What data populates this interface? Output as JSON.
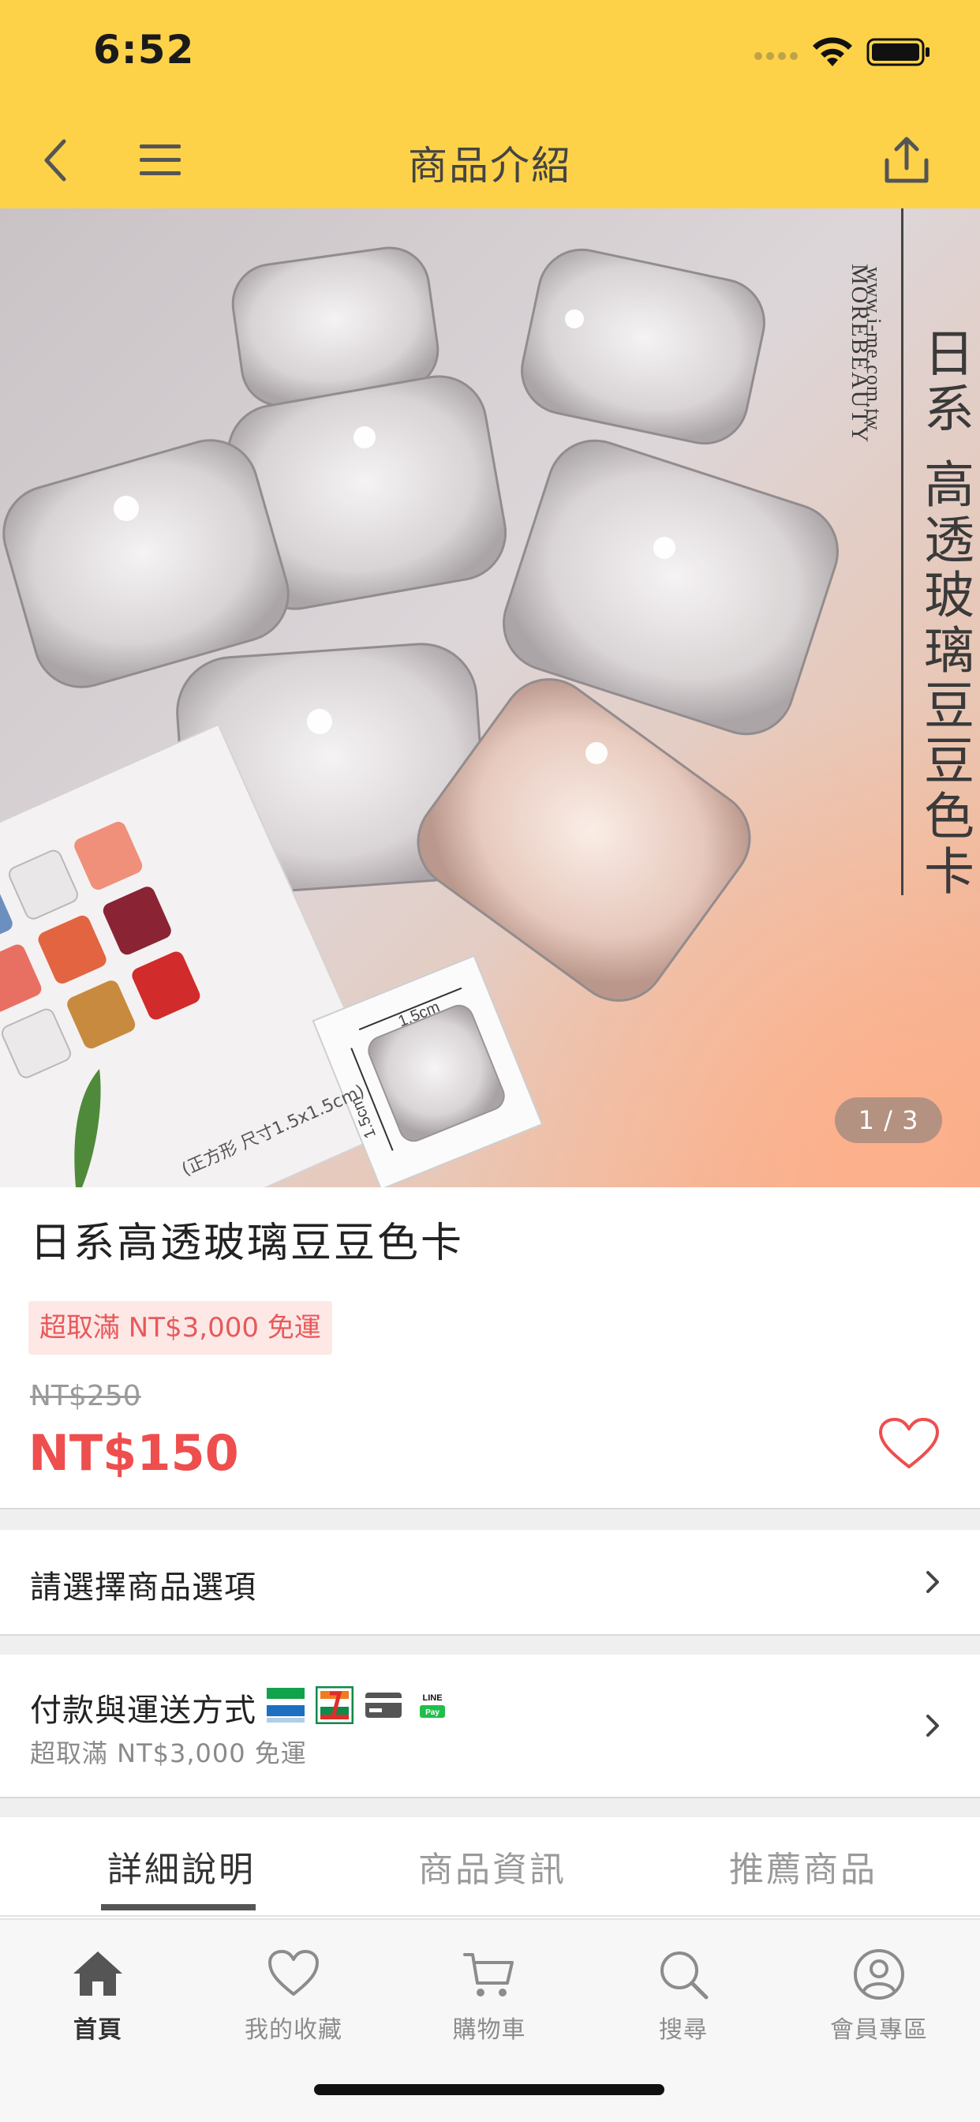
{
  "status_bar": {
    "time": "6:52"
  },
  "header": {
    "title": "商品介紹"
  },
  "hero": {
    "brand": "MOREBEAUTY",
    "site": "www.i-me.com.tw",
    "vertical_title": "日系 高透玻璃豆豆色卡",
    "card_size_label": "1.5cm",
    "caption": "(正方形 尺寸1.5x1.5cm)",
    "pager": "1 / 3"
  },
  "product": {
    "name": "日系高透玻璃豆豆色卡",
    "promo": "超取滿 NT$3,000 免運",
    "original_price": "NT$250",
    "price": "NT$150"
  },
  "rows": {
    "options_label": "請選擇商品選項",
    "payment_label": "付款與運送方式",
    "payment_sub": "超取滿 NT$3,000 免運",
    "payment_icons": [
      "familymart-icon",
      "seven-eleven-icon",
      "credit-card-icon",
      "line-pay-icon"
    ],
    "line_pay_text": "LINE Pay"
  },
  "tabs": [
    {
      "label": "詳細說明",
      "active": true
    },
    {
      "label": "商品資訊",
      "active": false
    },
    {
      "label": "推薦商品",
      "active": false
    }
  ],
  "bottom_nav": [
    {
      "label": "首頁",
      "icon": "home-icon",
      "active": true
    },
    {
      "label": "我的收藏",
      "icon": "heart-icon",
      "active": false
    },
    {
      "label": "購物車",
      "icon": "cart-icon",
      "active": false
    },
    {
      "label": "搜尋",
      "icon": "search-icon",
      "active": false
    },
    {
      "label": "會員專區",
      "icon": "user-icon",
      "active": false
    }
  ],
  "colors": {
    "header_bg": "#fdd248",
    "price_red": "#ee4e4e",
    "promo_bg": "#fde8e6",
    "promo_text": "#e8595a"
  }
}
